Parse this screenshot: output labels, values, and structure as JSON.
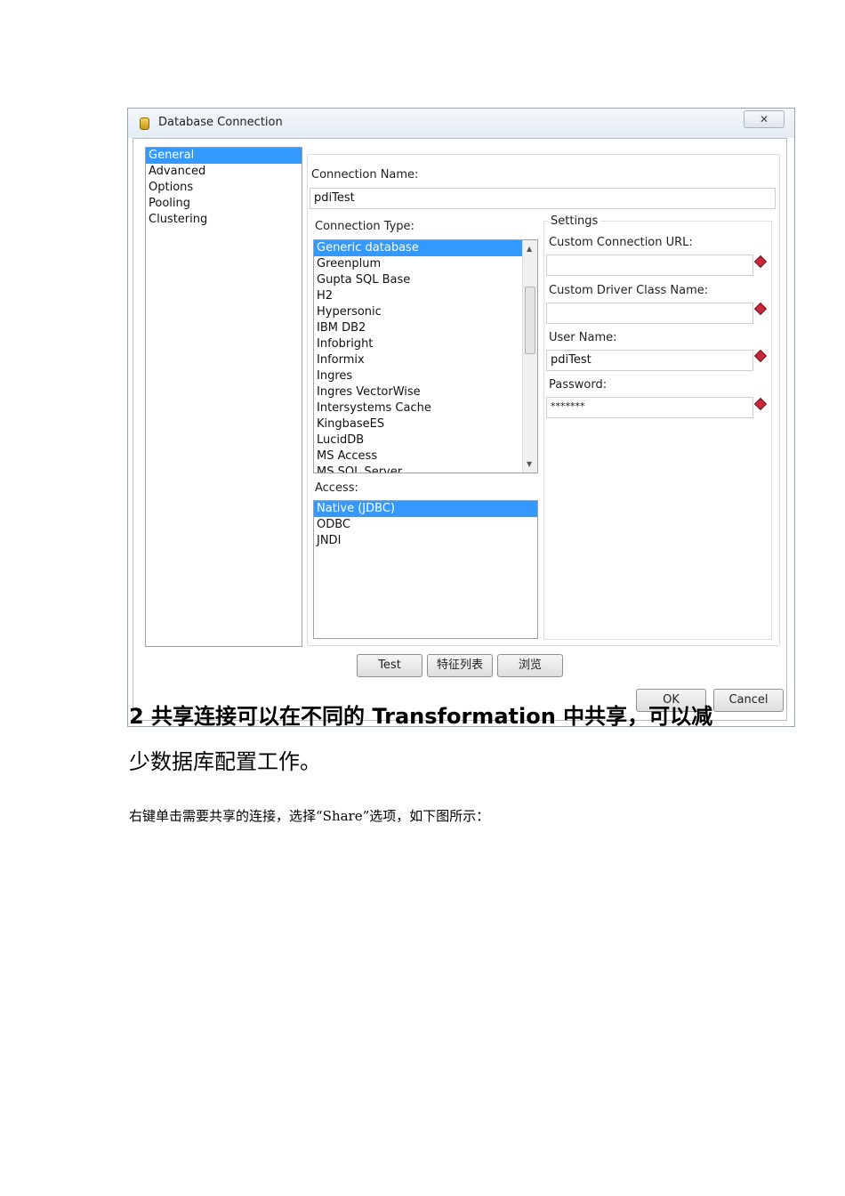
{
  "dialog": {
    "title": "Database Connection",
    "close_glyph": "✕",
    "nav_items": [
      {
        "label": "General",
        "selected": true
      },
      {
        "label": "Advanced",
        "selected": false
      },
      {
        "label": "Options",
        "selected": false
      },
      {
        "label": "Pooling",
        "selected": false
      },
      {
        "label": "Clustering",
        "selected": false
      }
    ],
    "connection_name_label": "Connection Name:",
    "connection_name_value": "pdiTest",
    "connection_type_label": "Connection Type:",
    "connection_types": [
      {
        "label": "Generic database",
        "selected": true
      },
      {
        "label": "Greenplum"
      },
      {
        "label": "Gupta SQL Base"
      },
      {
        "label": "H2"
      },
      {
        "label": "Hypersonic"
      },
      {
        "label": "IBM DB2"
      },
      {
        "label": "Infobright"
      },
      {
        "label": "Informix"
      },
      {
        "label": "Ingres"
      },
      {
        "label": "Ingres VectorWise"
      },
      {
        "label": "Intersystems Cache"
      },
      {
        "label": "KingbaseES"
      },
      {
        "label": "LucidDB"
      },
      {
        "label": "MS Access"
      },
      {
        "label": "MS SQL Server"
      }
    ],
    "access_label": "Access:",
    "access_types": [
      {
        "label": "Native (JDBC)",
        "selected": true
      },
      {
        "label": "ODBC"
      },
      {
        "label": "JNDI"
      }
    ],
    "settings": {
      "group_label": "Settings",
      "custom_url_label": "Custom Connection URL:",
      "custom_url_value": "",
      "custom_driver_label": "Custom Driver Class Name:",
      "custom_driver_value": "",
      "user_name_label": "User Name:",
      "user_name_value": "pdiTest",
      "password_label": "Password:",
      "password_value": "*******"
    },
    "buttons": {
      "test": "Test",
      "feature_list": "特征列表",
      "browse": "浏览",
      "ok": "OK",
      "cancel": "Cancel"
    }
  },
  "doc": {
    "heading_line1": "2 共享连接可以在不同的 Transformation 中共享，可以减",
    "heading_line2": "少数据库配置工作。",
    "paragraph": "右键单击需要共享的连接，选择“Share”选项，如下图所示："
  }
}
